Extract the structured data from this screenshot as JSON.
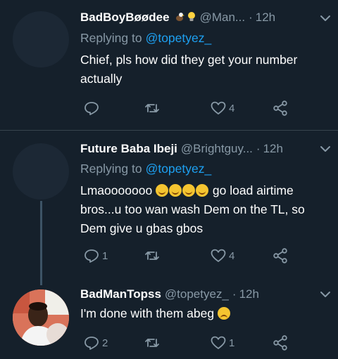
{
  "tweets": [
    {
      "name": "BadBoyBøødee",
      "badge_icons": [
        "eagle-icon",
        "lightbulb-icon"
      ],
      "handle": "@Man...",
      "time": "12h",
      "replying_label": "Replying to",
      "replying_mention": "@topetyez_",
      "text": "Chief, pls how did they get your number actually",
      "reply_count": "",
      "retweet_count": "",
      "like_count": "4"
    },
    {
      "name": "Future Baba Ibeji",
      "handle": "@Brightguy...",
      "time": "12h",
      "replying_label": "Replying to",
      "replying_mention": "@topetyez_",
      "text_before": "Lmaooooooo",
      "emoji_count": 4,
      "emoji_icon": "rolling-on-floor-laughing-icon",
      "text_after": "go load airtime bros...u too wan wash Dem on the TL, so Dem give u gbas gbos",
      "reply_count": "1",
      "retweet_count": "",
      "like_count": "4"
    },
    {
      "name": "BadManTopss",
      "handle": "@topetyez_",
      "time": "12h",
      "text": "I'm done with them abeg",
      "text_emoji_icon": "pensive-face-icon",
      "reply_count": "2",
      "retweet_count": "",
      "like_count": "1"
    }
  ],
  "colors": {
    "background": "#15202b",
    "secondary_text": "#8899a6",
    "link": "#1da1f2",
    "divider": "#38444d"
  }
}
